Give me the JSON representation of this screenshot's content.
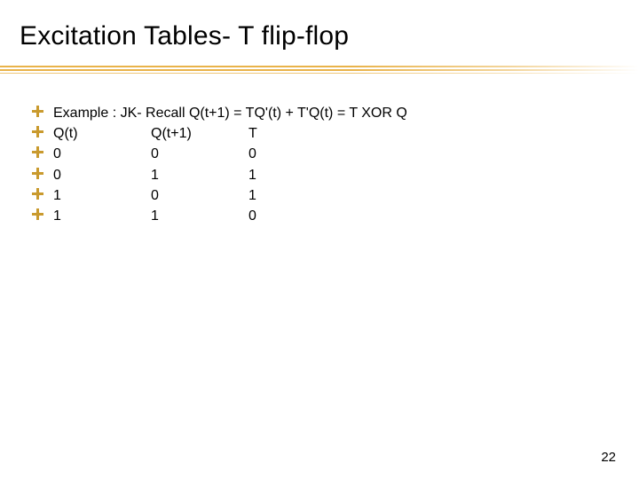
{
  "title": "Excitation Tables- T flip-flop",
  "bullets": {
    "line1": "Example : JK- Recall Q(t+1) = TQ'(t) + T'Q(t) = T XOR Q",
    "header": {
      "c1": "Q(t)",
      "c2": "Q(t+1)",
      "c3": "T"
    },
    "rows": [
      {
        "c1": "0",
        "c2": "0",
        "c3": "0"
      },
      {
        "c1": "0",
        "c2": "1",
        "c3": "1"
      },
      {
        "c1": "1",
        "c2": "0",
        "c3": "1"
      },
      {
        "c1": "1",
        "c2": "1",
        "c3": "0"
      }
    ]
  },
  "page_number": "22"
}
